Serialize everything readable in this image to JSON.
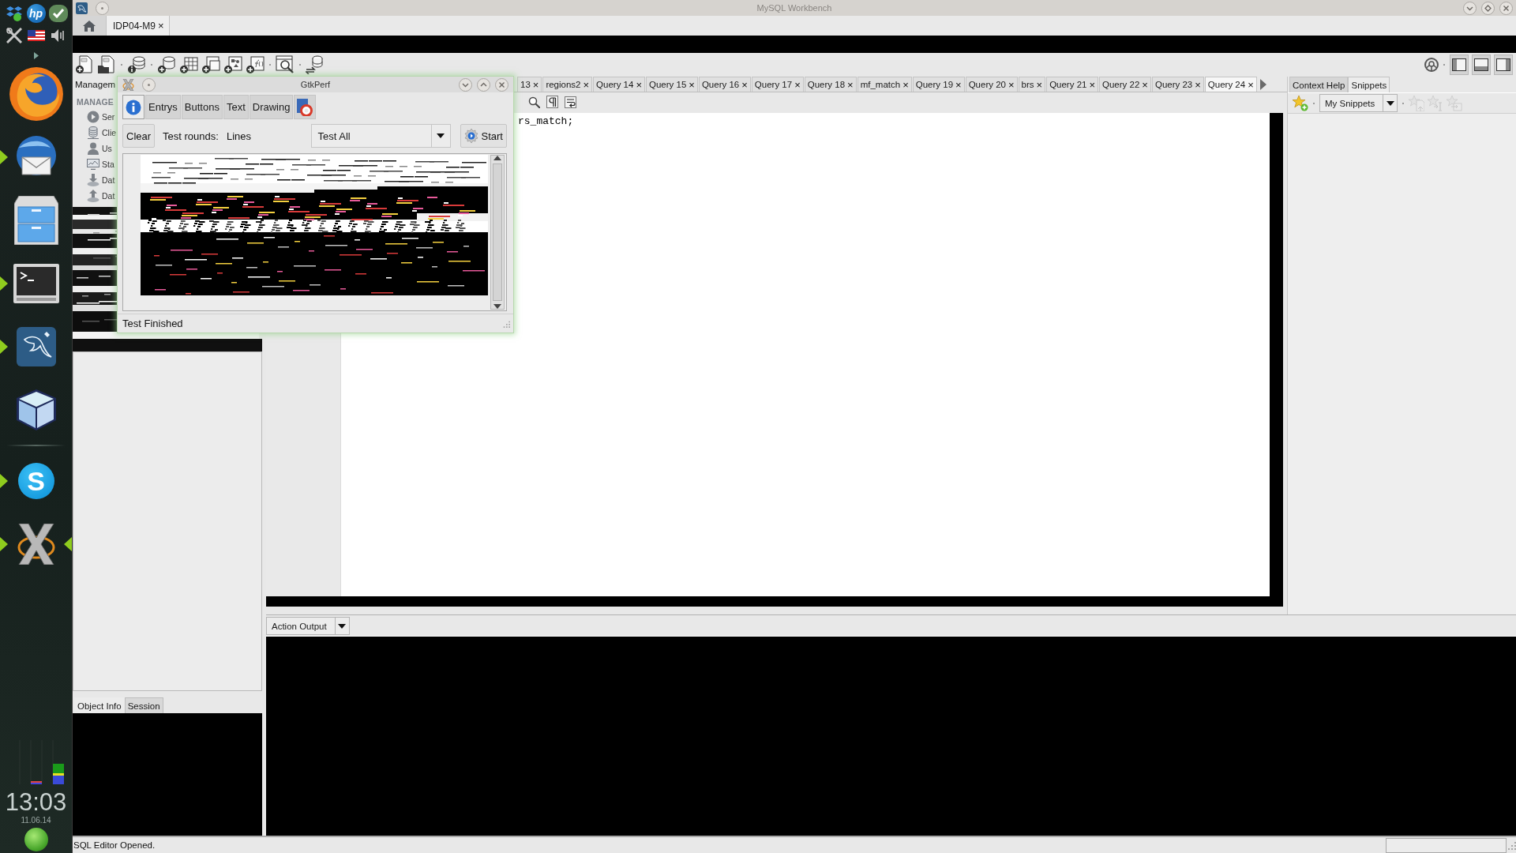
{
  "dock": {
    "tray": {
      "logo_text": "hp"
    },
    "app_groups": [
      [
        {
          "kind": "browser",
          "running": false,
          "focused": false
        },
        {
          "kind": "mail",
          "running": true,
          "focused": false
        },
        {
          "kind": "files",
          "running": false,
          "focused": false
        },
        {
          "kind": "terminal",
          "running": true,
          "focused": false
        },
        {
          "kind": "database",
          "running": true,
          "focused": false
        },
        {
          "kind": "cube",
          "running": false,
          "focused": false
        }
      ],
      [
        {
          "kind": "chat",
          "glyph": "S",
          "running": true,
          "focused": false
        },
        {
          "kind": "cross",
          "running": true,
          "focused": true
        }
      ]
    ],
    "clock": {
      "time": "13:03",
      "date": "11.06.14"
    }
  },
  "window": {
    "title": "MySQL Workbench"
  },
  "connection_tabs": [
    {
      "kind": "home",
      "selected": false
    },
    {
      "kind": "connection",
      "label": "IDP04-M9",
      "close": "×",
      "selected": true
    }
  ],
  "sidebar": {
    "tab": "Managem",
    "section": "MANAGE",
    "items": [
      {
        "kind": "play",
        "label": "Ser"
      },
      {
        "kind": "stack",
        "label": "Clie"
      },
      {
        "kind": "person",
        "label": "Us"
      },
      {
        "kind": "monitor",
        "label": "Sta"
      },
      {
        "kind": "download",
        "label": "Dat"
      },
      {
        "kind": "upload",
        "label": "Dat"
      }
    ],
    "bottom_tabs": [
      {
        "label": "Object Info",
        "selected": true
      },
      {
        "label": "Session",
        "selected": false
      }
    ]
  },
  "query_tabs": [
    {
      "label": "13",
      "close": "×",
      "selected": false
    },
    {
      "label": "regions2",
      "close": "×",
      "selected": false
    },
    {
      "label": "Query 14",
      "close": "×",
      "selected": false
    },
    {
      "label": "Query 15",
      "close": "×",
      "selected": false
    },
    {
      "label": "Query 16",
      "close": "×",
      "selected": false
    },
    {
      "label": "Query 17",
      "close": "×",
      "selected": false
    },
    {
      "label": "Query 18",
      "close": "×",
      "selected": false
    },
    {
      "label": "mf_match",
      "close": "×",
      "selected": false
    },
    {
      "label": "Query 19",
      "close": "×",
      "selected": false
    },
    {
      "label": "Query 20",
      "close": "×",
      "selected": false
    },
    {
      "label": "brs",
      "close": "×",
      "selected": false
    },
    {
      "label": "Query 21",
      "close": "×",
      "selected": false
    },
    {
      "label": "Query 22",
      "close": "×",
      "selected": false
    },
    {
      "label": "Query 23",
      "close": "×",
      "selected": false
    },
    {
      "label": "Query 24",
      "close": "×",
      "selected": true
    }
  ],
  "editor": {
    "code_line": "rs_match;"
  },
  "side_panel": {
    "tabs": [
      {
        "label": "Context Help",
        "selected": false
      },
      {
        "label": "Snippets",
        "selected": true
      }
    ],
    "snippet_list": "My Snippets",
    "tools": [
      {
        "kind": "page",
        "disabled": true
      },
      {
        "kind": "cursor",
        "disabled": true
      },
      {
        "kind": "box",
        "disabled": true
      }
    ]
  },
  "output": {
    "selector": "Action Output"
  },
  "status_bar": {
    "message": "SQL Editor Opened."
  },
  "gtkperf": {
    "title": "GtkPerf",
    "tabs": [
      {
        "kind": "info",
        "selected": true
      },
      {
        "kind": "text",
        "label": "Entrys",
        "selected": false
      },
      {
        "kind": "text",
        "label": "Buttons",
        "selected": false
      },
      {
        "kind": "text",
        "label": "Text",
        "selected": false
      },
      {
        "kind": "text",
        "label": "Drawing",
        "selected": false
      },
      {
        "kind": "help",
        "selected": false
      }
    ],
    "clear_button": "Clear",
    "rounds_label": "Test rounds:",
    "rounds_value": "Lines",
    "test_select": "Test All",
    "start_button": "Start",
    "status": "Test Finished"
  }
}
